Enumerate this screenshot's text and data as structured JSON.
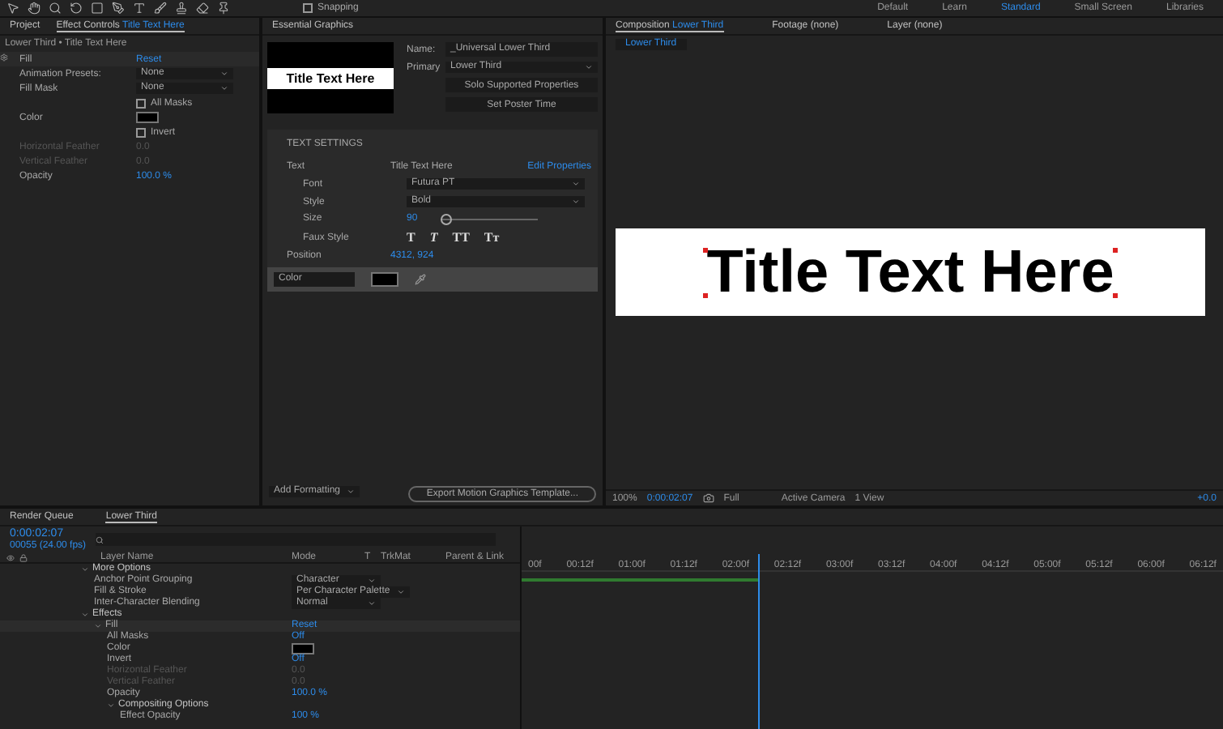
{
  "toolbar": {
    "snapping": {
      "label": "Snapping",
      "checked": false
    },
    "workspaces": [
      {
        "label": "Default",
        "selected": false
      },
      {
        "label": "Learn",
        "selected": false
      },
      {
        "label": "Standard",
        "selected": true
      },
      {
        "label": "Small Screen",
        "selected": false
      },
      {
        "label": "Libraries",
        "selected": false
      }
    ]
  },
  "effect_controls": {
    "tabs": [
      {
        "label": "Project",
        "selected": false
      },
      {
        "label": "Effect Controls",
        "target": "Title Text Here",
        "selected": true
      }
    ],
    "breadcrumb": "Lower Third • Title Text Here",
    "effect": {
      "name": "Fill",
      "reset": "Reset"
    },
    "rows": [
      {
        "kind": "dropdown",
        "label": "Animation Presets:",
        "value": "None"
      },
      {
        "kind": "dropdown",
        "label": "Fill Mask",
        "value": "None"
      },
      {
        "kind": "checkbox",
        "label": "All Masks",
        "checked": false
      },
      {
        "kind": "color",
        "label": "Color"
      },
      {
        "kind": "checkbox",
        "label": "Invert",
        "checked": false
      },
      {
        "kind": "value",
        "label": "Horizontal Feather",
        "value": "0.0",
        "disabled": true
      },
      {
        "kind": "value",
        "label": "Vertical Feather",
        "value": "0.0",
        "disabled": true
      },
      {
        "kind": "value",
        "label": "Opacity",
        "value": "100.0 %",
        "disabled": false
      }
    ]
  },
  "essential_graphics": {
    "title": "Essential Graphics",
    "preview_text": "Title Text Here",
    "name": {
      "label": "Name:",
      "value": "_Universal Lower Third"
    },
    "primary": {
      "label": "Primary",
      "value": "Lower Third"
    },
    "buttons": [
      "Solo Supported Properties",
      "Set Poster Time"
    ],
    "section": "TEXT SETTINGS",
    "text_row": {
      "label": "Text",
      "value": "Title Text Here",
      "link": "Edit Properties"
    },
    "font": {
      "label": "Font",
      "value": "Futura PT"
    },
    "style": {
      "label": "Style",
      "value": "Bold"
    },
    "size": {
      "label": "Size",
      "value": "90",
      "level": 0.06
    },
    "faux_style": {
      "label": "Faux Style",
      "glyphs": [
        "T",
        "T",
        "TT",
        "Tт"
      ]
    },
    "position": {
      "label": "Position",
      "value": "4312, 924"
    },
    "color_row": {
      "label": "Color"
    },
    "add_formatting": "Add Formatting",
    "export": "Export Motion Graphics Template..."
  },
  "composition": {
    "tabs": [
      {
        "label": "Composition",
        "target": "Lower Third",
        "selected": true
      },
      {
        "label": "Footage",
        "target": "(none)",
        "selected": false
      },
      {
        "label": "Layer",
        "target": "(none)",
        "selected": false
      }
    ],
    "subtab": "Lower Third",
    "canvas_text": "Title Text Here",
    "bar": {
      "zoom": "100%",
      "timecode": "0:00:02:07",
      "resolution": "Full",
      "camera": "Active Camera",
      "view": "1 View",
      "exposure": "+0.0"
    }
  },
  "timeline": {
    "tabs": [
      {
        "label": "Render Queue",
        "selected": false
      },
      {
        "label": "Lower Third",
        "selected": true
      }
    ],
    "timecode": "0:00:02:07",
    "frames": "00055 (24.00 fps)",
    "columns": [
      "Layer Name",
      "Mode",
      "T",
      "TrkMat",
      "Parent & Link"
    ],
    "ticks": [
      "00f",
      "00:12f",
      "01:00f",
      "01:12f",
      "02:00f",
      "02:12f",
      "03:00f",
      "03:12f",
      "04:00f",
      "04:12f",
      "05:00f",
      "05:12f",
      "06:00f",
      "06:12f"
    ],
    "playhead": {
      "level": 0.337
    },
    "layers": [
      {
        "kind": "group",
        "label": "More Options",
        "expanded": true,
        "children": [
          {
            "kind": "dropdown",
            "label": "Anchor Point Grouping",
            "value": "Character"
          },
          {
            "kind": "dropdown",
            "label": "Fill & Stroke",
            "value": "Per Character Palette"
          },
          {
            "kind": "dropdown",
            "label": "Inter-Character Blending",
            "value": "Normal"
          }
        ]
      },
      {
        "kind": "group",
        "label": "Effects",
        "expanded": true,
        "children": [
          {
            "kind": "effect",
            "label": "Fill",
            "value": "Reset",
            "expanded": true,
            "children": [
              {
                "kind": "value",
                "label": "All Masks",
                "value": "Off",
                "disabled": false
              },
              {
                "kind": "color",
                "label": "Color"
              },
              {
                "kind": "value",
                "label": "Invert",
                "value": "Off",
                "disabled": false
              },
              {
                "kind": "value",
                "label": "Horizontal Feather",
                "value": "0.0",
                "disabled": true
              },
              {
                "kind": "value",
                "label": "Vertical Feather",
                "value": "0.0",
                "disabled": true
              },
              {
                "kind": "value",
                "label": "Opacity",
                "value": "100.0 %",
                "disabled": false
              },
              {
                "kind": "group",
                "label": "Compositing Options",
                "expanded": true,
                "children": [
                  {
                    "kind": "value",
                    "label": "Effect Opacity",
                    "value": "100 %",
                    "disabled": false
                  }
                ]
              }
            ]
          }
        ]
      }
    ]
  }
}
